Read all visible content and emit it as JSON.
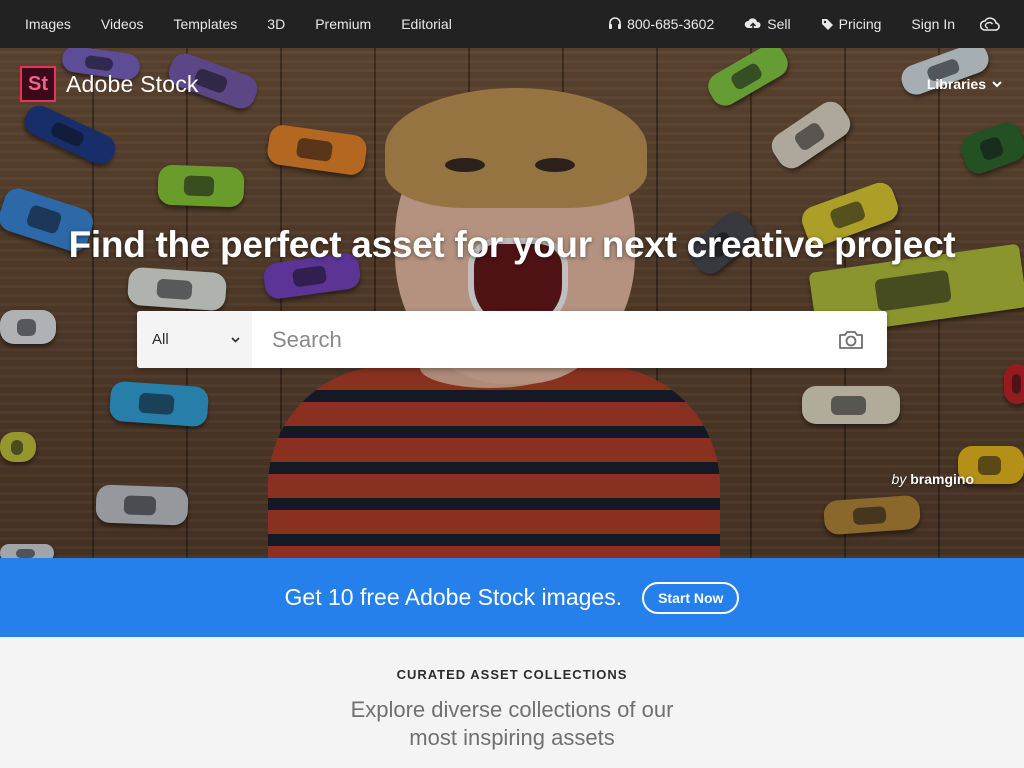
{
  "topnav": {
    "links": [
      "Images",
      "Videos",
      "Templates",
      "3D",
      "Premium",
      "Editorial"
    ],
    "phone": "800-685-3602",
    "sell": "Sell",
    "pricing": "Pricing",
    "sign_in": "Sign In",
    "icons": {
      "phone": "headset-icon",
      "sell": "cloud-upload-icon",
      "pricing": "tag-icon",
      "cc": "creative-cloud-icon"
    }
  },
  "logo": {
    "mark": "St",
    "text": "Adobe Stock"
  },
  "libraries": {
    "label": "Libraries"
  },
  "hero": {
    "headline": "Find the perfect asset for your next creative project",
    "credit_by": "by",
    "credit_author": "bramgino"
  },
  "search": {
    "scope": "All",
    "placeholder": "Search",
    "value": ""
  },
  "promo": {
    "message": "Get 10 free Adobe Stock images.",
    "button": "Start Now"
  },
  "curated": {
    "kicker": "CURATED ASSET COLLECTIONS",
    "subtitle": "Explore diverse collections of our most inspiring assets"
  },
  "colors": {
    "nav_bg": "#222222",
    "promo_bg": "#2680eb",
    "logo_accent": "#e8315b",
    "page_bg": "#f4f4f4"
  }
}
